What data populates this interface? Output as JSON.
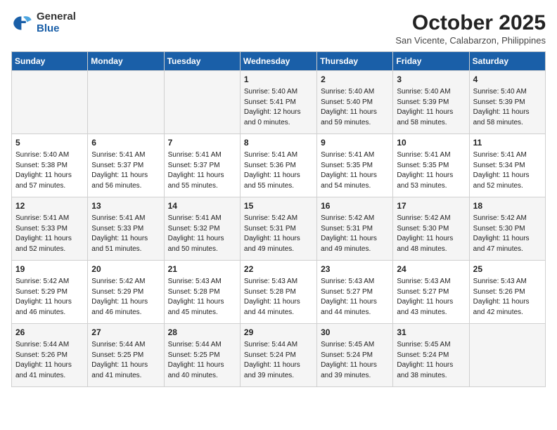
{
  "header": {
    "logo_general": "General",
    "logo_blue": "Blue",
    "month_title": "October 2025",
    "location": "San Vicente, Calabarzon, Philippines"
  },
  "weekdays": [
    "Sunday",
    "Monday",
    "Tuesday",
    "Wednesday",
    "Thursday",
    "Friday",
    "Saturday"
  ],
  "weeks": [
    [
      {
        "day": "",
        "info": ""
      },
      {
        "day": "",
        "info": ""
      },
      {
        "day": "",
        "info": ""
      },
      {
        "day": "1",
        "info": "Sunrise: 5:40 AM\nSunset: 5:41 PM\nDaylight: 12 hours\nand 0 minutes."
      },
      {
        "day": "2",
        "info": "Sunrise: 5:40 AM\nSunset: 5:40 PM\nDaylight: 11 hours\nand 59 minutes."
      },
      {
        "day": "3",
        "info": "Sunrise: 5:40 AM\nSunset: 5:39 PM\nDaylight: 11 hours\nand 58 minutes."
      },
      {
        "day": "4",
        "info": "Sunrise: 5:40 AM\nSunset: 5:39 PM\nDaylight: 11 hours\nand 58 minutes."
      }
    ],
    [
      {
        "day": "5",
        "info": "Sunrise: 5:40 AM\nSunset: 5:38 PM\nDaylight: 11 hours\nand 57 minutes."
      },
      {
        "day": "6",
        "info": "Sunrise: 5:41 AM\nSunset: 5:37 PM\nDaylight: 11 hours\nand 56 minutes."
      },
      {
        "day": "7",
        "info": "Sunrise: 5:41 AM\nSunset: 5:37 PM\nDaylight: 11 hours\nand 55 minutes."
      },
      {
        "day": "8",
        "info": "Sunrise: 5:41 AM\nSunset: 5:36 PM\nDaylight: 11 hours\nand 55 minutes."
      },
      {
        "day": "9",
        "info": "Sunrise: 5:41 AM\nSunset: 5:35 PM\nDaylight: 11 hours\nand 54 minutes."
      },
      {
        "day": "10",
        "info": "Sunrise: 5:41 AM\nSunset: 5:35 PM\nDaylight: 11 hours\nand 53 minutes."
      },
      {
        "day": "11",
        "info": "Sunrise: 5:41 AM\nSunset: 5:34 PM\nDaylight: 11 hours\nand 52 minutes."
      }
    ],
    [
      {
        "day": "12",
        "info": "Sunrise: 5:41 AM\nSunset: 5:33 PM\nDaylight: 11 hours\nand 52 minutes."
      },
      {
        "day": "13",
        "info": "Sunrise: 5:41 AM\nSunset: 5:33 PM\nDaylight: 11 hours\nand 51 minutes."
      },
      {
        "day": "14",
        "info": "Sunrise: 5:41 AM\nSunset: 5:32 PM\nDaylight: 11 hours\nand 50 minutes."
      },
      {
        "day": "15",
        "info": "Sunrise: 5:42 AM\nSunset: 5:31 PM\nDaylight: 11 hours\nand 49 minutes."
      },
      {
        "day": "16",
        "info": "Sunrise: 5:42 AM\nSunset: 5:31 PM\nDaylight: 11 hours\nand 49 minutes."
      },
      {
        "day": "17",
        "info": "Sunrise: 5:42 AM\nSunset: 5:30 PM\nDaylight: 11 hours\nand 48 minutes."
      },
      {
        "day": "18",
        "info": "Sunrise: 5:42 AM\nSunset: 5:30 PM\nDaylight: 11 hours\nand 47 minutes."
      }
    ],
    [
      {
        "day": "19",
        "info": "Sunrise: 5:42 AM\nSunset: 5:29 PM\nDaylight: 11 hours\nand 46 minutes."
      },
      {
        "day": "20",
        "info": "Sunrise: 5:42 AM\nSunset: 5:29 PM\nDaylight: 11 hours\nand 46 minutes."
      },
      {
        "day": "21",
        "info": "Sunrise: 5:43 AM\nSunset: 5:28 PM\nDaylight: 11 hours\nand 45 minutes."
      },
      {
        "day": "22",
        "info": "Sunrise: 5:43 AM\nSunset: 5:28 PM\nDaylight: 11 hours\nand 44 minutes."
      },
      {
        "day": "23",
        "info": "Sunrise: 5:43 AM\nSunset: 5:27 PM\nDaylight: 11 hours\nand 44 minutes."
      },
      {
        "day": "24",
        "info": "Sunrise: 5:43 AM\nSunset: 5:27 PM\nDaylight: 11 hours\nand 43 minutes."
      },
      {
        "day": "25",
        "info": "Sunrise: 5:43 AM\nSunset: 5:26 PM\nDaylight: 11 hours\nand 42 minutes."
      }
    ],
    [
      {
        "day": "26",
        "info": "Sunrise: 5:44 AM\nSunset: 5:26 PM\nDaylight: 11 hours\nand 41 minutes."
      },
      {
        "day": "27",
        "info": "Sunrise: 5:44 AM\nSunset: 5:25 PM\nDaylight: 11 hours\nand 41 minutes."
      },
      {
        "day": "28",
        "info": "Sunrise: 5:44 AM\nSunset: 5:25 PM\nDaylight: 11 hours\nand 40 minutes."
      },
      {
        "day": "29",
        "info": "Sunrise: 5:44 AM\nSunset: 5:24 PM\nDaylight: 11 hours\nand 39 minutes."
      },
      {
        "day": "30",
        "info": "Sunrise: 5:45 AM\nSunset: 5:24 PM\nDaylight: 11 hours\nand 39 minutes."
      },
      {
        "day": "31",
        "info": "Sunrise: 5:45 AM\nSunset: 5:24 PM\nDaylight: 11 hours\nand 38 minutes."
      },
      {
        "day": "",
        "info": ""
      }
    ]
  ]
}
